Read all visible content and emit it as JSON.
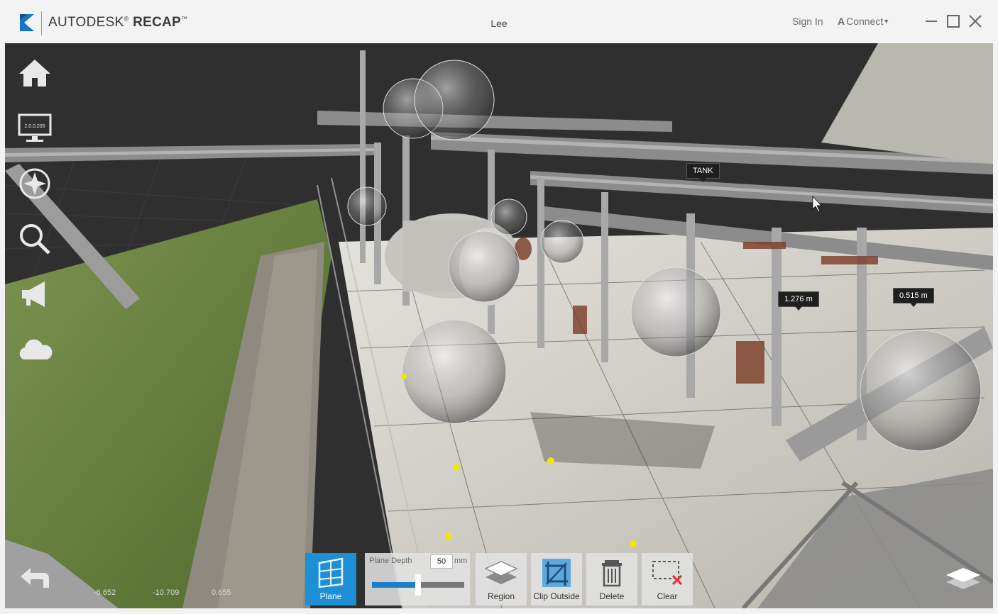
{
  "app": {
    "brand_main": "AUTODESK",
    "brand_product": "RECAP",
    "brand_tm": "™",
    "window_title": "Lee",
    "sign_in": "Sign In",
    "connect": "Connect",
    "connect_symbol": "A"
  },
  "nav": {
    "items": [
      {
        "name": "home"
      },
      {
        "name": "display-settings",
        "label": "2.0.0.205"
      },
      {
        "name": "navigation"
      },
      {
        "name": "search"
      },
      {
        "name": "announce"
      },
      {
        "name": "cloud"
      }
    ]
  },
  "scene": {
    "labels": {
      "tank": "TANK",
      "measure_1": "1.276 m",
      "measure_2": "0.515 m"
    },
    "coords": {
      "x": "-6.652",
      "y": "-10.709",
      "z": "0.655"
    }
  },
  "toolbar": {
    "plane": "Plane",
    "depth_label": "Plane Depth",
    "depth_value": "50",
    "depth_unit": "mm",
    "depth_fraction": 0.5,
    "region": "Region",
    "clip_outside": "Clip Outside",
    "delete": "Delete",
    "clear": "Clear"
  },
  "colors": {
    "accent": "#1c8fd6",
    "sky": "#2f2f2f",
    "grass": "#5e7a38",
    "concrete": "#d8d6d0",
    "measure_point": "#f2e600"
  }
}
